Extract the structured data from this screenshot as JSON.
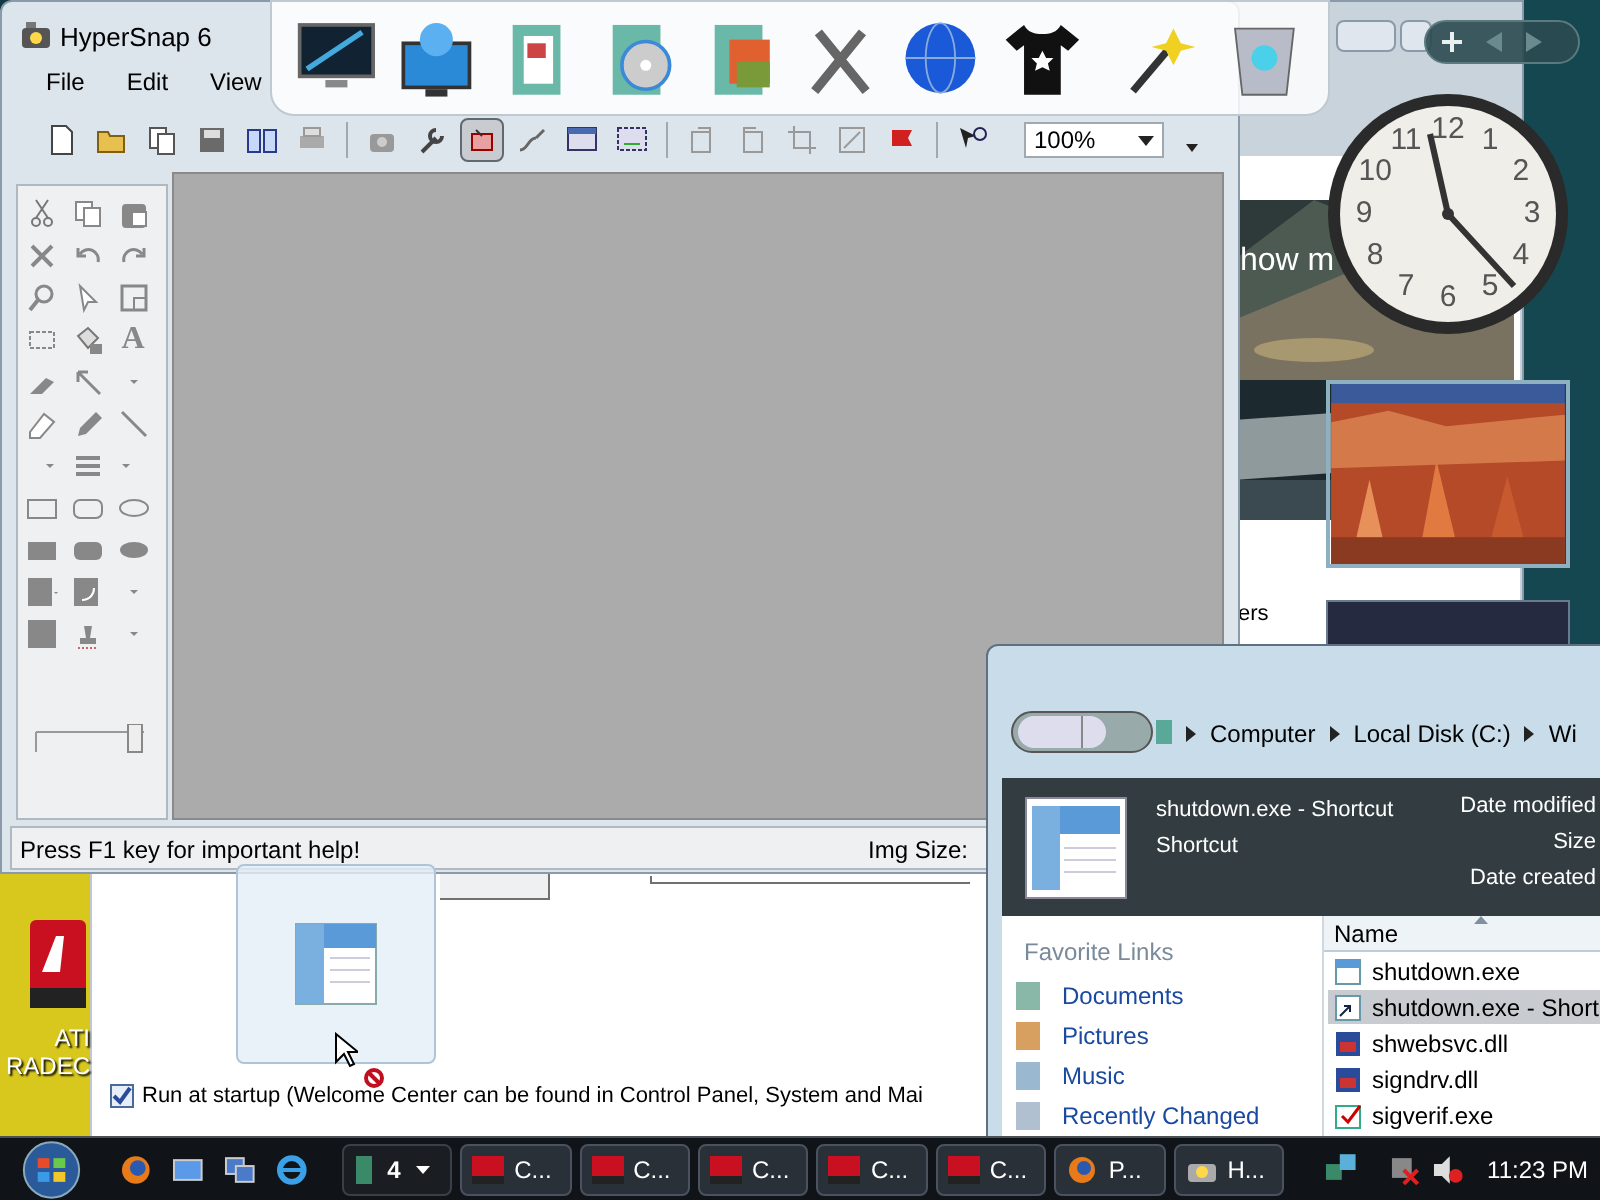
{
  "hypersnap": {
    "title": "HyperSnap 6",
    "menu": [
      "File",
      "Edit",
      "View"
    ],
    "toolbar": {
      "buttons": [
        {
          "pressed": false
        },
        {
          "pressed": false
        },
        {
          "pressed": false
        },
        {
          "pressed": false
        },
        {
          "pressed": false
        },
        {
          "pressed": false
        },
        {
          "pressed": false
        },
        {
          "pressed": false
        },
        {
          "pressed": true
        },
        {
          "pressed": false
        },
        {
          "pressed": false
        },
        {
          "pressed": false
        },
        {
          "pressed": false
        },
        {
          "pressed": false
        },
        {
          "pressed": false
        },
        {
          "pressed": false
        },
        {
          "pressed": false
        },
        {
          "pressed": false
        }
      ],
      "zoom": "100%"
    },
    "palette": {
      "text_tool": "A"
    },
    "status": {
      "hint": "Press F1 key for important help!",
      "img_size": "Img Size:"
    }
  },
  "background_window": {
    "texts": [
      "how m",
      "ers"
    ]
  },
  "clock_gadget": {
    "numerals": [
      "11",
      "12",
      "1",
      "10",
      "2",
      "9",
      "3",
      "8",
      "4",
      "7",
      "5",
      "6"
    ]
  },
  "welcome_center": {
    "startup": {
      "label": "Run at startup (Welcome Center can be found in Control Panel, System and Mai",
      "checked": true
    }
  },
  "desktop_icon": {
    "lines": [
      "ATI",
      "RADEC"
    ]
  },
  "explorer": {
    "breadcrumb": [
      "Computer",
      "Local Disk (C:)",
      "Wi"
    ],
    "details": {
      "name": "shutdown.exe - Shortcut",
      "type": "Shortcut",
      "labels": [
        "Date modified",
        "Size",
        "Date created"
      ]
    },
    "favorite_links": {
      "title": "Favorite Links",
      "items": [
        "Documents",
        "Pictures",
        "Music",
        "Recently Changed"
      ]
    },
    "files": {
      "column": "Name",
      "rows": [
        {
          "name": "shutdown.exe",
          "kind": "app",
          "selected": false
        },
        {
          "name": "shutdown.exe - Short",
          "kind": "shortcut",
          "selected": true
        },
        {
          "name": "shwebsvc.dll",
          "kind": "dll",
          "selected": false
        },
        {
          "name": "signdrv.dll",
          "kind": "dll",
          "selected": false
        },
        {
          "name": "sigverif.exe",
          "kind": "check",
          "selected": false
        }
      ]
    }
  },
  "taskbar": {
    "group_count": "4",
    "buttons": [
      {
        "label": "C...",
        "kind": "ati"
      },
      {
        "label": "C...",
        "kind": "ati"
      },
      {
        "label": "C...",
        "kind": "ati"
      },
      {
        "label": "C...",
        "kind": "ati"
      },
      {
        "label": "C...",
        "kind": "ati"
      },
      {
        "label": "P...",
        "kind": "firefox"
      },
      {
        "label": "H...",
        "kind": "camera"
      }
    ],
    "clock": "11:23 PM"
  }
}
